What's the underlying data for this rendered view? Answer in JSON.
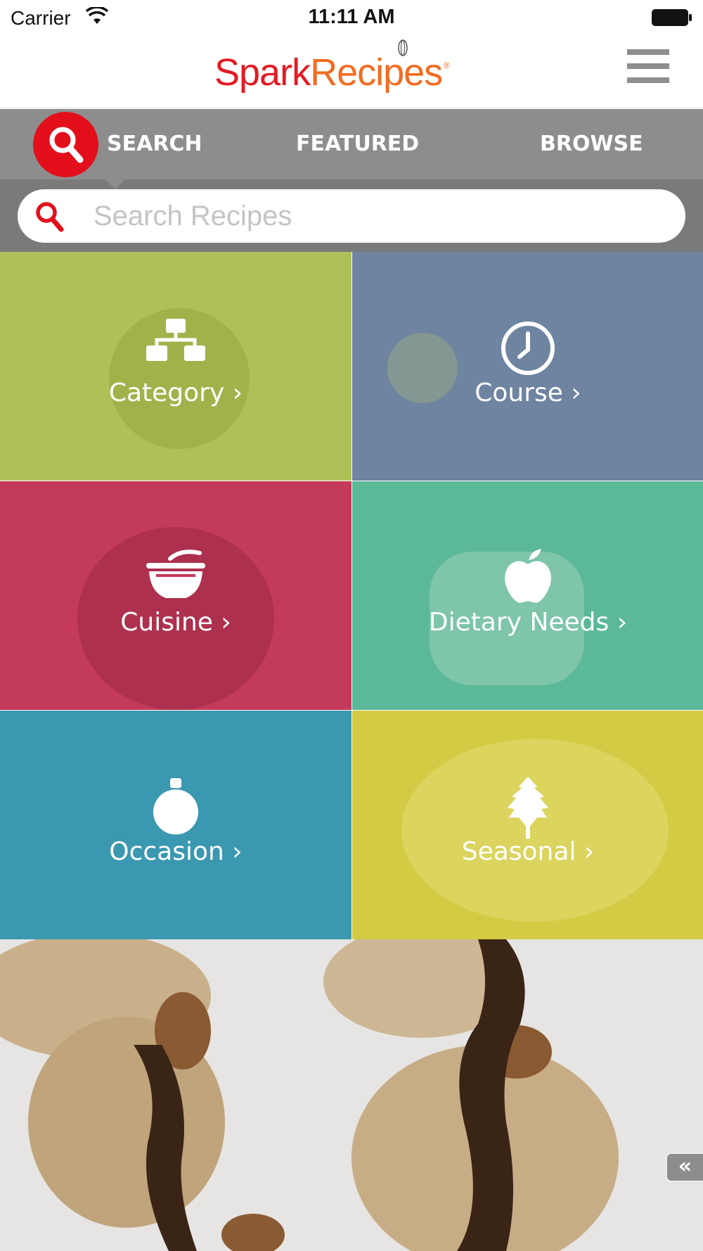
{
  "status_bar": {
    "carrier": "Carrier",
    "time": "11:11 AM"
  },
  "header": {
    "logo_part1": "Spark",
    "logo_part2": "Recipes",
    "logo_mark": "®",
    "menu_icon": "hamburger-icon"
  },
  "tabs": [
    {
      "label": "SEARCH",
      "icon": "search-icon",
      "active": true
    },
    {
      "label": "FEATURED"
    },
    {
      "label": "BROWSE"
    }
  ],
  "search": {
    "placeholder": "Search Recipes",
    "value": ""
  },
  "tiles": [
    {
      "label": "Category ›",
      "icon": "hierarchy-icon",
      "color": "#aec157"
    },
    {
      "label": "Course ›",
      "icon": "clock-icon",
      "color": "#6e84a0"
    },
    {
      "label": "Cuisine ›",
      "icon": "bowl-icon",
      "color": "#c43a5a"
    },
    {
      "label": "Dietary Needs ›",
      "icon": "apple-icon",
      "color": "#5bb898"
    },
    {
      "label": "Occasion ›",
      "icon": "ornament-icon",
      "color": "#3a98b0"
    },
    {
      "label": "Seasonal ›",
      "icon": "leaf-icon",
      "color": "#d3cb43"
    }
  ],
  "collapse_button": {
    "label": "«",
    "icon": "double-chevron-left-icon"
  },
  "colors": {
    "brand_red": "#e31b23",
    "brand_orange": "#f26b21",
    "tab_bar": "#8d8d8d"
  }
}
